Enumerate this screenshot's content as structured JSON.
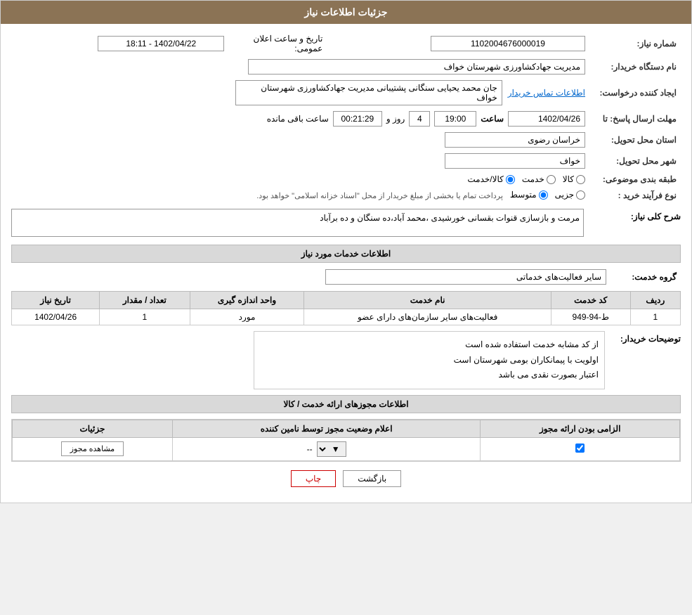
{
  "header": {
    "title": "جزئیات اطلاعات نیاز"
  },
  "fields": {
    "need_number_label": "شماره نیاز:",
    "need_number_value": "1102004676000019",
    "announce_date_label": "تاریخ و ساعت اعلان عمومی:",
    "announce_date_value": "1402/04/22 - 18:11",
    "buyer_name_label": "نام دستگاه خریدار:",
    "buyer_name_value": "مدیریت جهادکشاورزی شهرستان خواف",
    "creator_label": "ایجاد کننده درخواست:",
    "creator_value": "جان محمد یحیایی سنگانی پشتیبانی مدیریت جهادکشاورزی شهرستان خواف",
    "contact_link": "اطلاعات تماس خریدار",
    "send_deadline_label": "مهلت ارسال پاسخ: تا",
    "send_deadline_date": "1402/04/26",
    "send_deadline_time": "19:00",
    "send_deadline_days": "4",
    "send_deadline_remaining": "00:21:29",
    "send_deadline_days_label": "روز و",
    "send_deadline_hours_label": "ساعت باقی مانده",
    "province_label": "استان محل تحویل:",
    "province_value": "خراسان رضوی",
    "city_label": "شهر محل تحویل:",
    "city_value": "خواف",
    "category_label": "طبقه بندی موضوعی:",
    "category_kala": "کالا",
    "category_khadamat": "خدمت",
    "category_kala_khadamat": "کالا/خدمت",
    "purchase_type_label": "نوع فرآیند خرید :",
    "purchase_jozii": "جزیی",
    "purchase_motavaset": "متوسط",
    "purchase_note": "پرداخت تمام یا بخشی از مبلغ خریدار از محل \"اسناد خزانه اسلامی\" خواهد بود."
  },
  "need_description": {
    "title": "شرح کلی نیاز:",
    "value": "مرمت و بازسازی قنوات بقسانی خورشیدی ،محمد آباد،ده سنگان و ده برآباد"
  },
  "services_section": {
    "title": "اطلاعات خدمات مورد نیاز",
    "service_group_label": "گروه خدمت:",
    "service_group_value": "سایر فعالیت‌های خدماتی",
    "table": {
      "headers": [
        "ردیف",
        "کد خدمت",
        "نام خدمت",
        "واحد اندازه گیری",
        "تعداد / مقدار",
        "تاریخ نیاز"
      ],
      "rows": [
        {
          "row": "1",
          "code": "ط-94-949",
          "name": "فعالیت‌های سایر سازمان‌های دارای عضو",
          "unit": "مورد",
          "quantity": "1",
          "date": "1402/04/26"
        }
      ]
    },
    "buyer_notes_label": "توضیحات خریدار:",
    "buyer_notes_lines": [
      "از کد مشابه خدمت استفاده شده است",
      "اولویت با پیمانکاران بومی شهرستان است",
      "اعتبار بصورت نقدی می باشد"
    ]
  },
  "license_section": {
    "title": "اطلاعات مجوزهای ارائه خدمت / کالا",
    "table": {
      "headers": [
        "الزامی بودن ارائه مجوز",
        "اعلام وضعیت مجوز توسط نامین کننده",
        "جزئیات"
      ],
      "rows": [
        {
          "required": true,
          "status_value": "--",
          "details_btn": "مشاهده مجوز"
        }
      ]
    }
  },
  "buttons": {
    "print": "چاپ",
    "back": "بازگشت"
  }
}
